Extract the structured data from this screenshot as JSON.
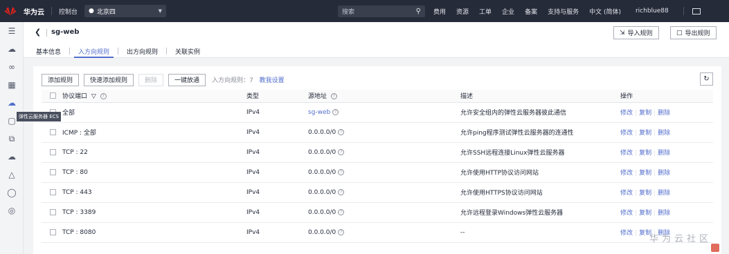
{
  "topbar": {
    "brand": "华为云",
    "console": "控制台",
    "region": "北京四",
    "search_placeholder": "搜索",
    "nav": [
      "费用",
      "资源",
      "工单",
      "企业",
      "备案",
      "支持与服务",
      "中文 (简体)"
    ],
    "user": "richblue88"
  },
  "rail_tooltip": "弹性云服务器 ECS",
  "header": {
    "title": "sg-web",
    "import_label": "导入规则",
    "export_label": "导出规则",
    "tabs": [
      "基本信息",
      "入方向规则",
      "出方向规则",
      "关联实例"
    ]
  },
  "toolbar": {
    "add": "添加规则",
    "quick_add": "快速添加规则",
    "delete": "删除",
    "allow_all": "一键放通",
    "count_label": "入方向规则：7",
    "tutorial": "教我设置"
  },
  "table": {
    "headers": [
      "协议端口",
      "类型",
      "源地址",
      "描述",
      "操作"
    ],
    "ops": [
      "修改",
      "复制",
      "删除"
    ],
    "rows": [
      {
        "proto": "全部",
        "type": "IPv4",
        "src": "sg-web",
        "desc": "允许安全组内的弹性云服务器彼此通信"
      },
      {
        "proto": "ICMP : 全部",
        "type": "IPv4",
        "src": "0.0.0.0/0",
        "desc": "允许ping程序测试弹性云服务器的连通性"
      },
      {
        "proto": "TCP : 22",
        "type": "IPv4",
        "src": "0.0.0.0/0",
        "desc": "允许SSH远程连接Linux弹性云服务器"
      },
      {
        "proto": "TCP : 80",
        "type": "IPv4",
        "src": "0.0.0.0/0",
        "desc": "允许使用HTTP协议访问网站"
      },
      {
        "proto": "TCP : 443",
        "type": "IPv4",
        "src": "0.0.0.0/0",
        "desc": "允许使用HTTPS协议访问网站"
      },
      {
        "proto": "TCP : 3389",
        "type": "IPv4",
        "src": "0.0.0.0/0",
        "desc": "允许远程登录Windows弹性云服务器"
      },
      {
        "proto": "TCP : 8080",
        "type": "IPv4",
        "src": "0.0.0.0/0",
        "desc": "--"
      }
    ]
  },
  "watermark": "华为云社区",
  "colors": {
    "topbar": "#262b3a",
    "accent": "#526ecc",
    "brand_red": "#e1211b"
  }
}
